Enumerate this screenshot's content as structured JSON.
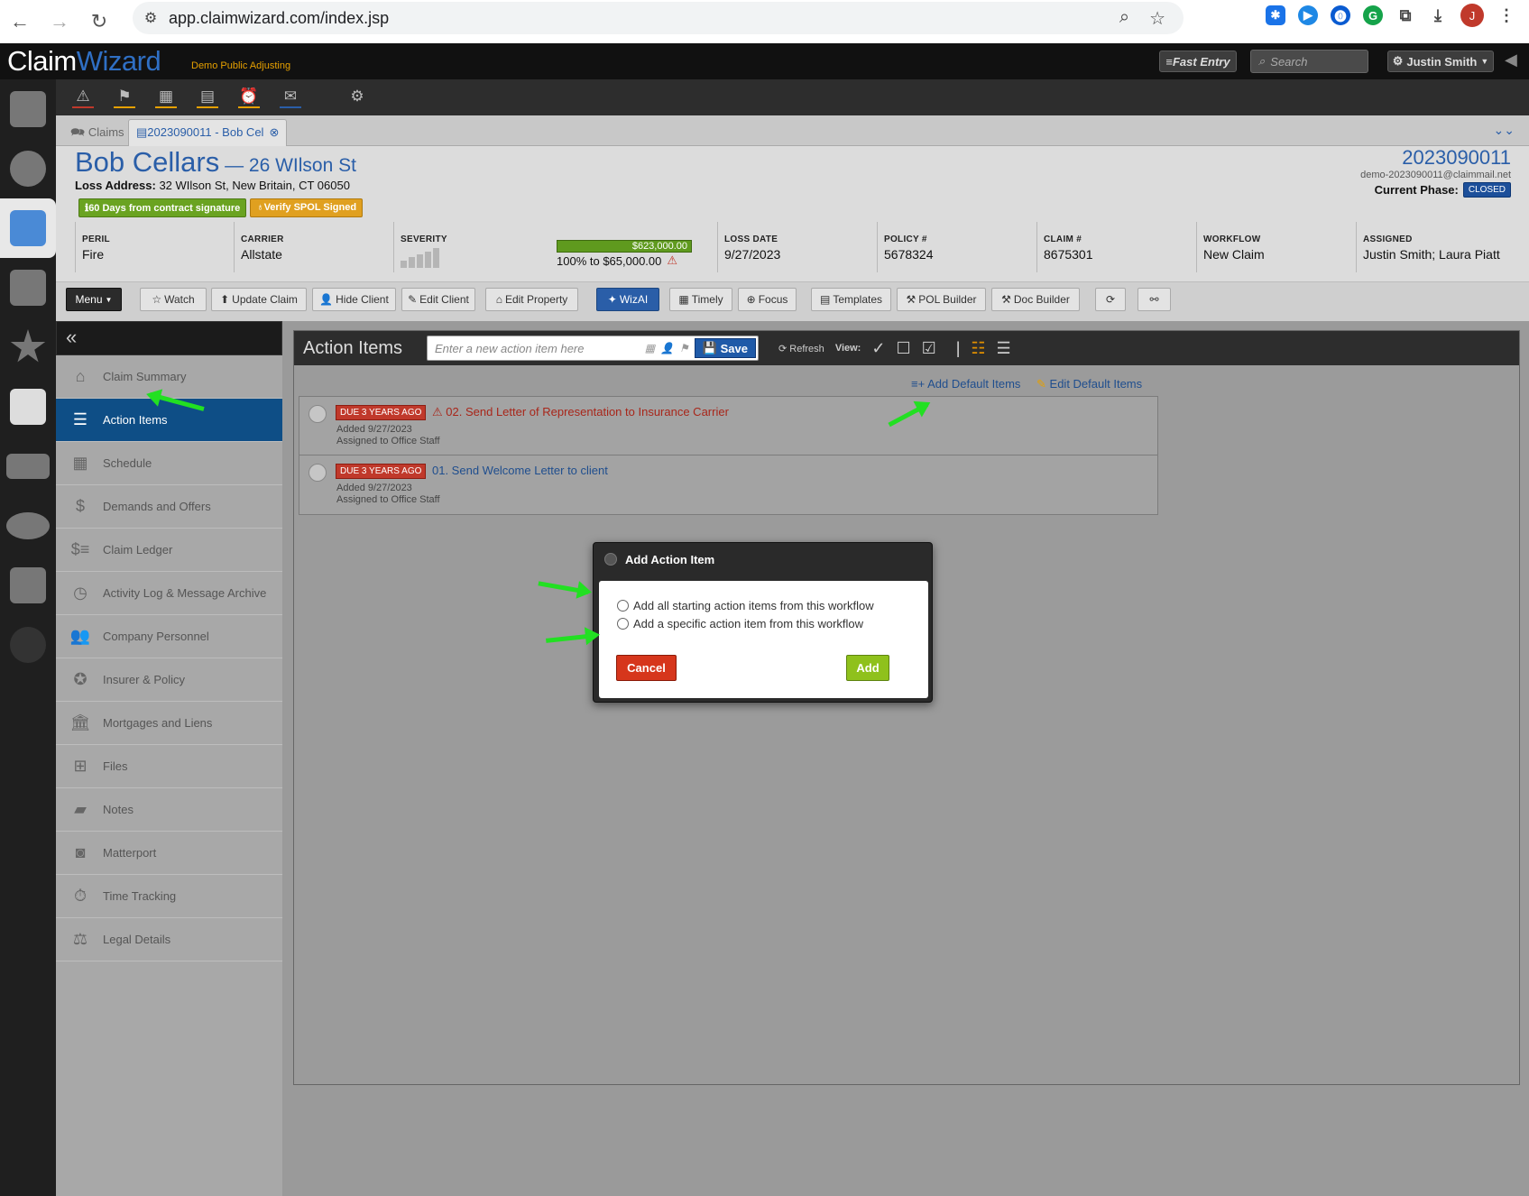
{
  "browser": {
    "url": "app.claimwizard.com/index.jsp",
    "profile_initial": "J"
  },
  "app": {
    "logo_a": "Claim",
    "logo_b": "Wizard",
    "company": "Demo Public Adjusting",
    "fast_entry": "≡Fast Entry",
    "search_placeholder": "Search",
    "user_name": "Justin Smith"
  },
  "tabs": {
    "claims": "Claims",
    "current": "2023090011 - Bob Cel"
  },
  "claim": {
    "client_name": "Bob Cellars",
    "address_short": "26 WIlson St",
    "loss_address_label": "Loss Address:",
    "loss_address": "32 WIlson St, New Britain, CT 06050",
    "badge_days": "60 Days from contract signature",
    "badge_spol": "Verify SPOL Signed",
    "claim_number": "2023090011",
    "claim_email": "demo-2023090011@claimmail.net",
    "phase_label": "Current Phase:",
    "phase": "CLOSED"
  },
  "info": {
    "peril_label": "PERIL",
    "peril": "Fire",
    "carrier_label": "CARRIER",
    "carrier": "Allstate",
    "severity_label": "SEVERITY",
    "amount": "$623,000.00",
    "progress_text": "100% to $65,000.00",
    "progress_fraction": 1.0,
    "loss_date_label": "LOSS DATE",
    "loss_date": "9/27/2023",
    "policy_label": "POLICY #",
    "policy": "5678324",
    "claimno_label": "CLAIM #",
    "claimno": "8675301",
    "workflow_label": "WORKFLOW",
    "workflow": "New Claim",
    "assigned_label": "ASSIGNED",
    "assigned": "Justin Smith; Laura Piatt"
  },
  "actions": {
    "menu": "Menu",
    "watch": "Watch",
    "update_claim": "Update Claim",
    "hide_client": "Hide Client",
    "edit_client": "Edit Client",
    "edit_property": "Edit Property",
    "wizai": "WizAI",
    "timely": "Timely",
    "focus": "Focus",
    "templates": "Templates",
    "pol_builder": "POL Builder",
    "doc_builder": "Doc Builder"
  },
  "sidebar": {
    "items": [
      {
        "label": "Claim Summary"
      },
      {
        "label": "Action Items"
      },
      {
        "label": "Schedule"
      },
      {
        "label": "Demands and Offers"
      },
      {
        "label": "Claim Ledger"
      },
      {
        "label": "Activity Log & Message Archive"
      },
      {
        "label": "Company Personnel"
      },
      {
        "label": "Insurer & Policy"
      },
      {
        "label": "Mortgages and Liens"
      },
      {
        "label": "Files"
      },
      {
        "label": "Notes"
      },
      {
        "label": "Matterport"
      },
      {
        "label": "Time Tracking"
      },
      {
        "label": "Legal Details"
      }
    ]
  },
  "main": {
    "title": "Action Items",
    "new_placeholder": "Enter a new action item here",
    "save": "Save",
    "refresh": "Refresh",
    "view_label": "View:",
    "add_default": "Add Default Items",
    "edit_default": "Edit Default Items",
    "items": [
      {
        "due": "DUE 3 YEARS AGO",
        "title": "02. Send Letter of Representation to Insurance Carrier",
        "added": "Added 9/27/2023",
        "assigned": "Assigned to Office Staff"
      },
      {
        "due": "DUE 3 YEARS AGO",
        "title": "01. Send Welcome Letter to client",
        "added": "Added 9/27/2023",
        "assigned": "Assigned to Office Staff"
      }
    ]
  },
  "modal": {
    "title": "Add Action Item",
    "option_all": "Add all starting action items from this workflow",
    "option_specific": "Add a specific action item from this workflow",
    "cancel": "Cancel",
    "add": "Add"
  },
  "colors": {
    "brand_blue": "#2a5ea8",
    "active_nav": "#0e4e86",
    "annotation_arrow": "#22e022",
    "danger": "#c0392b",
    "success": "#8fc11c"
  }
}
